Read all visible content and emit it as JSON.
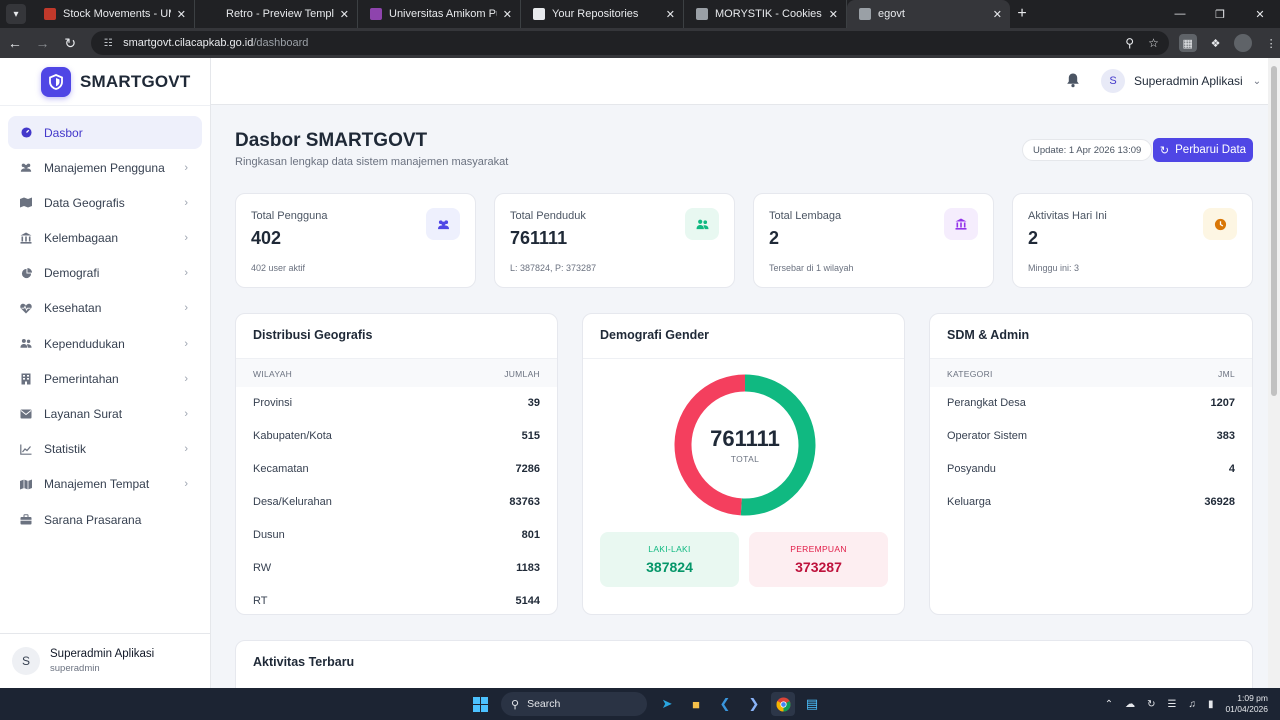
{
  "browser": {
    "tabs": [
      {
        "title": "Stock Movements - UMKM Go",
        "favicon_color": "#c0392b",
        "active": false
      },
      {
        "title": "Retro - Preview Template - jadi",
        "favicon_color": "#202124",
        "active": false
      },
      {
        "title": "Universitas Amikom Purwokerto",
        "favicon_color": "#8e44ad",
        "active": false
      },
      {
        "title": "Your Repositories",
        "favicon_color": "#e8eaed",
        "active": false
      },
      {
        "title": "MORYSTIK - Cookies Lezat Bern",
        "favicon_color": "#9aa0a6",
        "active": false
      },
      {
        "title": "egovt",
        "favicon_color": "#9aa0a6",
        "active": true
      }
    ],
    "new_tab_label": "+",
    "url_host": "smartgovt.cilacapkab.go.id",
    "url_path": "/dashboard"
  },
  "app": {
    "brand": "SMARTGOVT",
    "accent_color": "#4f46e5",
    "sidebar": {
      "items": [
        {
          "label": "Dasbor",
          "icon": "gauge-icon",
          "active": true,
          "has_children": false
        },
        {
          "label": "Manajemen Pengguna",
          "icon": "users-icon",
          "active": false,
          "has_children": true
        },
        {
          "label": "Data Geografis",
          "icon": "map-icon",
          "active": false,
          "has_children": true
        },
        {
          "label": "Kelembagaan",
          "icon": "institution-icon",
          "active": false,
          "has_children": true
        },
        {
          "label": "Demografi",
          "icon": "pie-icon",
          "active": false,
          "has_children": true
        },
        {
          "label": "Kesehatan",
          "icon": "heart-pulse-icon",
          "active": false,
          "has_children": true
        },
        {
          "label": "Kependudukan",
          "icon": "people-icon",
          "active": false,
          "has_children": true
        },
        {
          "label": "Pemerintahan",
          "icon": "building-icon",
          "active": false,
          "has_children": true
        },
        {
          "label": "Layanan Surat",
          "icon": "envelope-icon",
          "active": false,
          "has_children": true
        },
        {
          "label": "Statistik",
          "icon": "chart-icon",
          "active": false,
          "has_children": true
        },
        {
          "label": "Manajemen Tempat",
          "icon": "map-pin-icon",
          "active": false,
          "has_children": true
        },
        {
          "label": "Sarana Prasarana",
          "icon": "toolbox-icon",
          "active": false,
          "has_children": false
        }
      ],
      "user_initial": "S",
      "user_name": "Superadmin Aplikasi",
      "user_role": "superadmin"
    },
    "topbar": {
      "user_initial": "S",
      "user_name": "Superadmin Aplikasi"
    },
    "page": {
      "title": "Dasbor SMARTGOVT",
      "subtitle": "Ringkasan lengkap data sistem manajemen masyarakat",
      "update_text": "Update: 1 Apr 2026 13:09",
      "refresh_label": "Perbarui Data"
    },
    "stats": [
      {
        "label": "Total Pengguna",
        "value": "402",
        "footer": "402 user aktif",
        "icon": "users-icon",
        "icon_color": "#4f46e5",
        "icon_bg": "#eef0fd"
      },
      {
        "label": "Total Penduduk",
        "value": "761111",
        "footer": "L: 387824, P: 373287",
        "icon": "people-icon",
        "icon_color": "#10b981",
        "icon_bg": "#e8f8f1"
      },
      {
        "label": "Total Lembaga",
        "value": "2",
        "footer": "Tersebar di 1 wilayah",
        "icon": "institution-icon",
        "icon_color": "#9333ea",
        "icon_bg": "#f5edfd"
      },
      {
        "label": "Aktivitas Hari Ini",
        "value": "2",
        "footer": "Minggu ini: 3",
        "icon": "clock-icon",
        "icon_color": "#d97706",
        "icon_bg": "#fdf6e3"
      }
    ],
    "geo": {
      "title": "Distribusi Geografis",
      "col1": "WILAYAH",
      "col2": "JUMLAH",
      "rows": [
        {
          "k": "Provinsi",
          "v": "39"
        },
        {
          "k": "Kabupaten/Kota",
          "v": "515"
        },
        {
          "k": "Kecamatan",
          "v": "7286"
        },
        {
          "k": "Desa/Kelurahan",
          "v": "83763"
        },
        {
          "k": "Dusun",
          "v": "801"
        },
        {
          "k": "RW",
          "v": "1183"
        },
        {
          "k": "RT",
          "v": "5144"
        }
      ]
    },
    "gender": {
      "title": "Demografi Gender",
      "total": "761111",
      "total_label": "TOTAL",
      "male_label": "LAKI-LAKI",
      "male_value": "387824",
      "male_color": "#10b981",
      "female_label": "PEREMPUAN",
      "female_value": "373287",
      "female_color": "#f43f5e"
    },
    "sdm": {
      "title": "SDM & Admin",
      "col1": "KATEGORI",
      "col2": "JML",
      "rows": [
        {
          "k": "Perangkat Desa",
          "v": "1207"
        },
        {
          "k": "Operator Sistem",
          "v": "383"
        },
        {
          "k": "Posyandu",
          "v": "4"
        },
        {
          "k": "Keluarga",
          "v": "36928"
        }
      ]
    },
    "recent": {
      "title": "Aktivitas Terbaru"
    }
  },
  "taskbar": {
    "search_placeholder": "Search",
    "time": "1:09 pm",
    "date": "01/04/2026"
  }
}
